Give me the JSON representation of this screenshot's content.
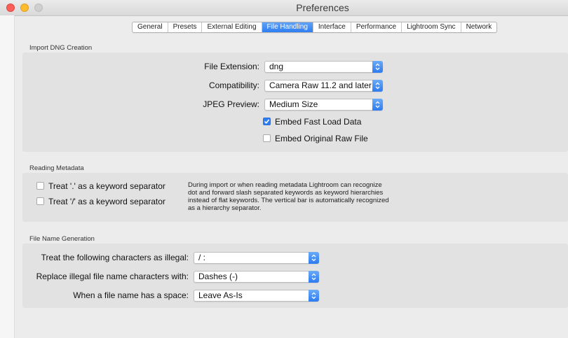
{
  "window": {
    "title": "Preferences"
  },
  "tabs": [
    {
      "label": "General"
    },
    {
      "label": "Presets"
    },
    {
      "label": "External Editing"
    },
    {
      "label": "File Handling",
      "active": true
    },
    {
      "label": "Interface"
    },
    {
      "label": "Performance"
    },
    {
      "label": "Lightroom Sync"
    },
    {
      "label": "Network"
    }
  ],
  "import_dng": {
    "title": "Import DNG Creation",
    "file_extension": {
      "label": "File Extension:",
      "value": "dng"
    },
    "compatibility": {
      "label": "Compatibility:",
      "value": "Camera Raw 11.2 and later"
    },
    "jpeg_preview": {
      "label": "JPEG Preview:",
      "value": "Medium Size"
    },
    "embed_fast_load": {
      "label": "Embed Fast Load Data",
      "checked": true
    },
    "embed_original_raw": {
      "label": "Embed Original Raw File",
      "checked": false
    }
  },
  "reading_metadata": {
    "title": "Reading Metadata",
    "dot_separator": {
      "label": "Treat '.' as a keyword separator",
      "checked": false
    },
    "slash_separator": {
      "label": "Treat '/' as a keyword separator",
      "checked": false
    },
    "description_lines": [
      "During import or when reading metadata Lightroom can recognize",
      "dot and forward slash separated keywords as keyword hierarchies",
      "instead of flat keywords. The vertical bar is automatically recognized",
      "as a hierarchy separator."
    ]
  },
  "file_name_generation": {
    "title": "File Name Generation",
    "illegal_chars": {
      "label": "Treat the following characters as illegal:",
      "value": "/ :"
    },
    "replace_chars": {
      "label": "Replace illegal file name characters with:",
      "value": "Dashes (-)"
    },
    "space_handling": {
      "label": "When a file name has a space:",
      "value": "Leave As-Is"
    }
  },
  "colors": {
    "accent": "#2f7ef2",
    "panel": "#e2e2e2",
    "window": "#ececec"
  }
}
